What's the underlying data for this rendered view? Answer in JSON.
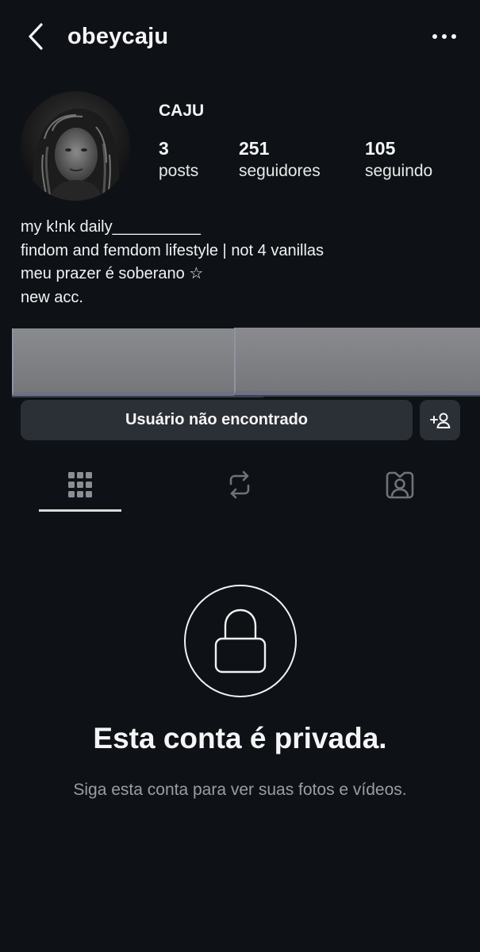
{
  "header": {
    "username": "obeycaju",
    "back_icon": "chevron-left-icon",
    "more_icon": "more-horizontal-icon"
  },
  "profile": {
    "display_name": "CAJU",
    "stats": [
      {
        "count": "3",
        "label": "posts"
      },
      {
        "count": "251",
        "label": "seguidores"
      },
      {
        "count": "105",
        "label": "seguindo"
      }
    ],
    "bio": "my k!nk daily__________\nfindom and femdom lifestyle | not 4 vanillas\nmeu prazer é soberano ☆\nnew acc."
  },
  "actions": {
    "primary_label": "Usuário não encontrado",
    "add_icon": "add-user-icon"
  },
  "tabs": [
    {
      "name": "grid",
      "icon": "grid-icon",
      "active": true
    },
    {
      "name": "reposts",
      "icon": "repost-icon",
      "active": false
    },
    {
      "name": "tagged",
      "icon": "tagged-icon",
      "active": false
    }
  ],
  "private_notice": {
    "title": "Esta conta é privada.",
    "subtitle": "Siga esta conta para ver suas fotos e vídeos."
  },
  "colors": {
    "background": "#0e1217",
    "button": "#2b2f36",
    "muted_text": "#9a9da3"
  }
}
